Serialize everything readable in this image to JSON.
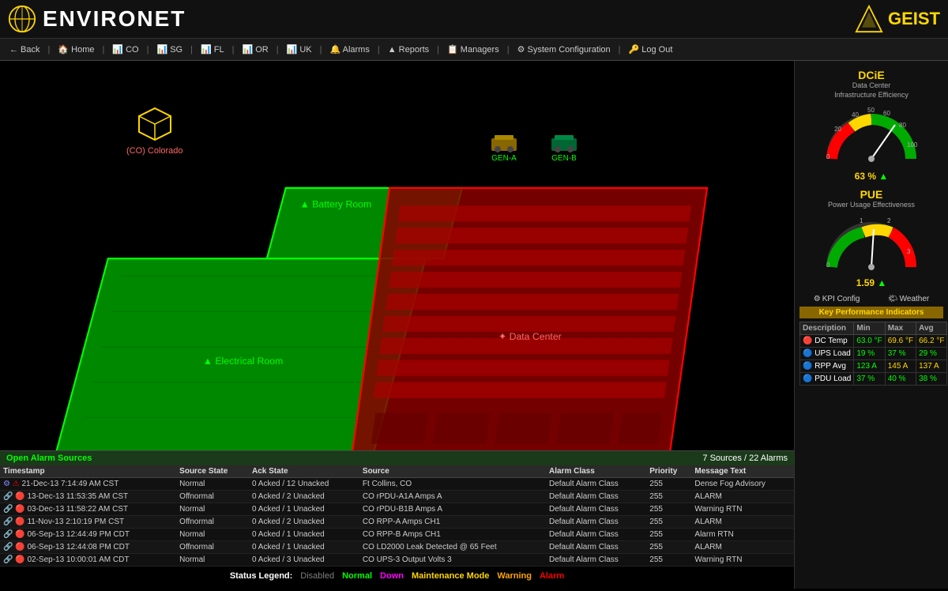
{
  "header": {
    "logo_text": "ENVIRONET",
    "geist_text": "GEIST"
  },
  "navbar": {
    "items": [
      {
        "label": "Back",
        "icon": "←"
      },
      {
        "label": "Home",
        "icon": "🏠"
      },
      {
        "label": "CO",
        "icon": "📊"
      },
      {
        "label": "SG",
        "icon": "📊"
      },
      {
        "label": "FL",
        "icon": "📊"
      },
      {
        "label": "OR",
        "icon": "📊"
      },
      {
        "label": "UK",
        "icon": "📊"
      },
      {
        "label": "Alarms",
        "icon": "🔔"
      },
      {
        "label": "Reports",
        "icon": "▲"
      },
      {
        "label": "Managers",
        "icon": "📋"
      },
      {
        "label": "System Configuration",
        "icon": "⚙"
      },
      {
        "label": "Log Out",
        "icon": "🔑"
      }
    ]
  },
  "floor_plan": {
    "co_label": "(CO) Colorado",
    "battery_room": "Battery Room",
    "electrical_room": "Electrical Room",
    "data_center": "Data Center",
    "gen_a": "GEN-A",
    "gen_b": "GEN-B"
  },
  "status_legend": {
    "label": "Status Legend:",
    "items": [
      {
        "text": "Disabled",
        "color": "#808080"
      },
      {
        "text": "Normal",
        "color": "#00ff00"
      },
      {
        "text": "Down",
        "color": "#ff00ff"
      },
      {
        "text": "Maintenance Mode",
        "color": "#FFD700"
      },
      {
        "text": "Warning",
        "color": "#FFA500"
      },
      {
        "text": "Alarm",
        "color": "#ff0000"
      }
    ]
  },
  "dcie": {
    "title": "DCiE",
    "subtitle": "Data Center\nInfrastructure Efficiency",
    "value": "63 %",
    "arrow": "▲"
  },
  "pue": {
    "title": "PUE",
    "subtitle": "Power Usage Effectiveness",
    "value": "1.59",
    "arrow": "▲"
  },
  "kpi_buttons": {
    "config": "KPI Config",
    "weather": "Weather"
  },
  "kpi": {
    "title": "Key Performance Indicators",
    "headers": [
      "Description",
      "Min",
      "Max",
      "Avg"
    ],
    "rows": [
      {
        "desc": "DC Temp",
        "min": "63.0 °F",
        "max": "69.6 °F",
        "avg": "66.2 °F",
        "min_color": "green",
        "max_color": "yellow",
        "avg_color": "yellow",
        "icon": "🔴"
      },
      {
        "desc": "UPS Load",
        "min": "19 %",
        "max": "37 %",
        "avg": "29 %",
        "min_color": "green",
        "max_color": "green",
        "avg_color": "green",
        "icon": "🔵"
      },
      {
        "desc": "RPP Avg",
        "min": "123 A",
        "max": "145 A",
        "avg": "137 A",
        "min_color": "green",
        "max_color": "yellow",
        "avg_color": "yellow",
        "icon": "🔵"
      },
      {
        "desc": "PDU Load",
        "min": "37 %",
        "max": "40 %",
        "avg": "38 %",
        "min_color": "green",
        "max_color": "green",
        "avg_color": "green",
        "icon": "🔵"
      }
    ]
  },
  "alarms": {
    "header": "Open Alarm Sources",
    "count": "7 Sources / 22 Alarms",
    "columns": [
      "Timestamp",
      "Source State",
      "Ack State",
      "Source",
      "Alarm Class",
      "Priority",
      "Message Text"
    ],
    "rows": [
      {
        "icon": "⚙",
        "ts_icon": "⚠",
        "timestamp": "21-Dec-13 7:14:49 AM CST",
        "source_state": "Normal",
        "ack_state": "0 Acked / 12 Unacked",
        "source": "Ft Collins, CO",
        "alarm_class": "Default Alarm Class",
        "priority": "255",
        "message": "Dense Fog Advisory"
      },
      {
        "icon": "🔗",
        "ts_icon": "🔴",
        "timestamp": "13-Dec-13 11:53:35 AM CST",
        "source_state": "Offnormal",
        "ack_state": "0 Acked / 2 Unacked",
        "source": "CO rPDU-A1A Amps A",
        "alarm_class": "Default Alarm Class",
        "priority": "255",
        "message": "ALARM"
      },
      {
        "icon": "🔗",
        "ts_icon": "🔴",
        "timestamp": "03-Dec-13 11:58:22 AM CST",
        "source_state": "Normal",
        "ack_state": "0 Acked / 1 Unacked",
        "source": "CO rPDU-B1B Amps A",
        "alarm_class": "Default Alarm Class",
        "priority": "255",
        "message": "Warning RTN"
      },
      {
        "icon": "🔗",
        "ts_icon": "🔴",
        "timestamp": "11-Nov-13 2:10:19 PM CST",
        "source_state": "Offnormal",
        "ack_state": "0 Acked / 2 Unacked",
        "source": "CO RPP-A Amps CH1",
        "alarm_class": "Default Alarm Class",
        "priority": "255",
        "message": "ALARM"
      },
      {
        "icon": "🔗",
        "ts_icon": "🔴",
        "timestamp": "06-Sep-13 12:44:49 PM CDT",
        "source_state": "Normal",
        "ack_state": "0 Acked / 1 Unacked",
        "source": "CO RPP-B Amps CH1",
        "alarm_class": "Default Alarm Class",
        "priority": "255",
        "message": "Alarm RTN"
      },
      {
        "icon": "🔗",
        "ts_icon": "🔴",
        "timestamp": "06-Sep-13 12:44:08 PM CDT",
        "source_state": "Offnormal",
        "ack_state": "0 Acked / 1 Unacked",
        "source": "CO LD2000 Leak Detected @ 65 Feet",
        "alarm_class": "Default Alarm Class",
        "priority": "255",
        "message": "ALARM"
      },
      {
        "icon": "🔗",
        "ts_icon": "🔴",
        "timestamp": "02-Sep-13 10:00:01 AM CDT",
        "source_state": "Normal",
        "ack_state": "0 Acked / 3 Unacked",
        "source": "CO UPS-3 Output Volts 3",
        "alarm_class": "Default Alarm Class",
        "priority": "255",
        "message": "Warning RTN"
      }
    ]
  }
}
